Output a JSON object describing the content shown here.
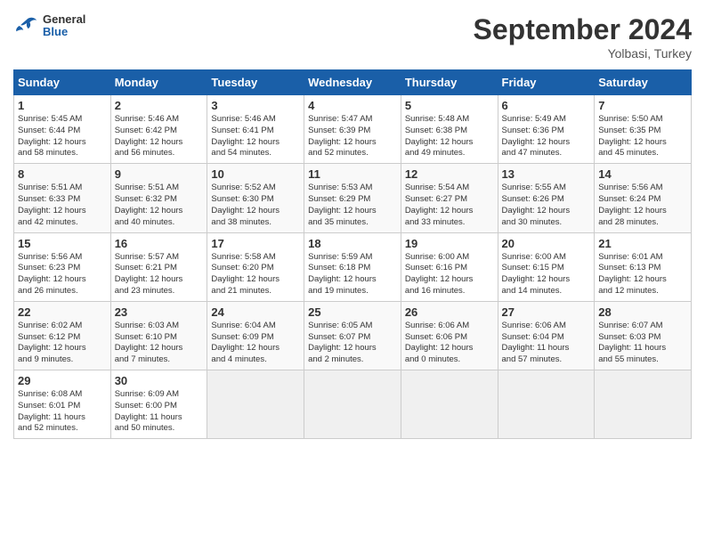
{
  "header": {
    "logo_general": "General",
    "logo_blue": "Blue",
    "month_title": "September 2024",
    "subtitle": "Yolbasi, Turkey"
  },
  "days_of_week": [
    "Sunday",
    "Monday",
    "Tuesday",
    "Wednesday",
    "Thursday",
    "Friday",
    "Saturday"
  ],
  "weeks": [
    [
      {
        "day": "1",
        "info": "Sunrise: 5:45 AM\nSunset: 6:44 PM\nDaylight: 12 hours\nand 58 minutes."
      },
      {
        "day": "2",
        "info": "Sunrise: 5:46 AM\nSunset: 6:42 PM\nDaylight: 12 hours\nand 56 minutes."
      },
      {
        "day": "3",
        "info": "Sunrise: 5:46 AM\nSunset: 6:41 PM\nDaylight: 12 hours\nand 54 minutes."
      },
      {
        "day": "4",
        "info": "Sunrise: 5:47 AM\nSunset: 6:39 PM\nDaylight: 12 hours\nand 52 minutes."
      },
      {
        "day": "5",
        "info": "Sunrise: 5:48 AM\nSunset: 6:38 PM\nDaylight: 12 hours\nand 49 minutes."
      },
      {
        "day": "6",
        "info": "Sunrise: 5:49 AM\nSunset: 6:36 PM\nDaylight: 12 hours\nand 47 minutes."
      },
      {
        "day": "7",
        "info": "Sunrise: 5:50 AM\nSunset: 6:35 PM\nDaylight: 12 hours\nand 45 minutes."
      }
    ],
    [
      {
        "day": "8",
        "info": "Sunrise: 5:51 AM\nSunset: 6:33 PM\nDaylight: 12 hours\nand 42 minutes."
      },
      {
        "day": "9",
        "info": "Sunrise: 5:51 AM\nSunset: 6:32 PM\nDaylight: 12 hours\nand 40 minutes."
      },
      {
        "day": "10",
        "info": "Sunrise: 5:52 AM\nSunset: 6:30 PM\nDaylight: 12 hours\nand 38 minutes."
      },
      {
        "day": "11",
        "info": "Sunrise: 5:53 AM\nSunset: 6:29 PM\nDaylight: 12 hours\nand 35 minutes."
      },
      {
        "day": "12",
        "info": "Sunrise: 5:54 AM\nSunset: 6:27 PM\nDaylight: 12 hours\nand 33 minutes."
      },
      {
        "day": "13",
        "info": "Sunrise: 5:55 AM\nSunset: 6:26 PM\nDaylight: 12 hours\nand 30 minutes."
      },
      {
        "day": "14",
        "info": "Sunrise: 5:56 AM\nSunset: 6:24 PM\nDaylight: 12 hours\nand 28 minutes."
      }
    ],
    [
      {
        "day": "15",
        "info": "Sunrise: 5:56 AM\nSunset: 6:23 PM\nDaylight: 12 hours\nand 26 minutes."
      },
      {
        "day": "16",
        "info": "Sunrise: 5:57 AM\nSunset: 6:21 PM\nDaylight: 12 hours\nand 23 minutes."
      },
      {
        "day": "17",
        "info": "Sunrise: 5:58 AM\nSunset: 6:20 PM\nDaylight: 12 hours\nand 21 minutes."
      },
      {
        "day": "18",
        "info": "Sunrise: 5:59 AM\nSunset: 6:18 PM\nDaylight: 12 hours\nand 19 minutes."
      },
      {
        "day": "19",
        "info": "Sunrise: 6:00 AM\nSunset: 6:16 PM\nDaylight: 12 hours\nand 16 minutes."
      },
      {
        "day": "20",
        "info": "Sunrise: 6:00 AM\nSunset: 6:15 PM\nDaylight: 12 hours\nand 14 minutes."
      },
      {
        "day": "21",
        "info": "Sunrise: 6:01 AM\nSunset: 6:13 PM\nDaylight: 12 hours\nand 12 minutes."
      }
    ],
    [
      {
        "day": "22",
        "info": "Sunrise: 6:02 AM\nSunset: 6:12 PM\nDaylight: 12 hours\nand 9 minutes."
      },
      {
        "day": "23",
        "info": "Sunrise: 6:03 AM\nSunset: 6:10 PM\nDaylight: 12 hours\nand 7 minutes."
      },
      {
        "day": "24",
        "info": "Sunrise: 6:04 AM\nSunset: 6:09 PM\nDaylight: 12 hours\nand 4 minutes."
      },
      {
        "day": "25",
        "info": "Sunrise: 6:05 AM\nSunset: 6:07 PM\nDaylight: 12 hours\nand 2 minutes."
      },
      {
        "day": "26",
        "info": "Sunrise: 6:06 AM\nSunset: 6:06 PM\nDaylight: 12 hours\nand 0 minutes."
      },
      {
        "day": "27",
        "info": "Sunrise: 6:06 AM\nSunset: 6:04 PM\nDaylight: 11 hours\nand 57 minutes."
      },
      {
        "day": "28",
        "info": "Sunrise: 6:07 AM\nSunset: 6:03 PM\nDaylight: 11 hours\nand 55 minutes."
      }
    ],
    [
      {
        "day": "29",
        "info": "Sunrise: 6:08 AM\nSunset: 6:01 PM\nDaylight: 11 hours\nand 52 minutes."
      },
      {
        "day": "30",
        "info": "Sunrise: 6:09 AM\nSunset: 6:00 PM\nDaylight: 11 hours\nand 50 minutes."
      },
      {
        "day": "",
        "info": ""
      },
      {
        "day": "",
        "info": ""
      },
      {
        "day": "",
        "info": ""
      },
      {
        "day": "",
        "info": ""
      },
      {
        "day": "",
        "info": ""
      }
    ]
  ]
}
